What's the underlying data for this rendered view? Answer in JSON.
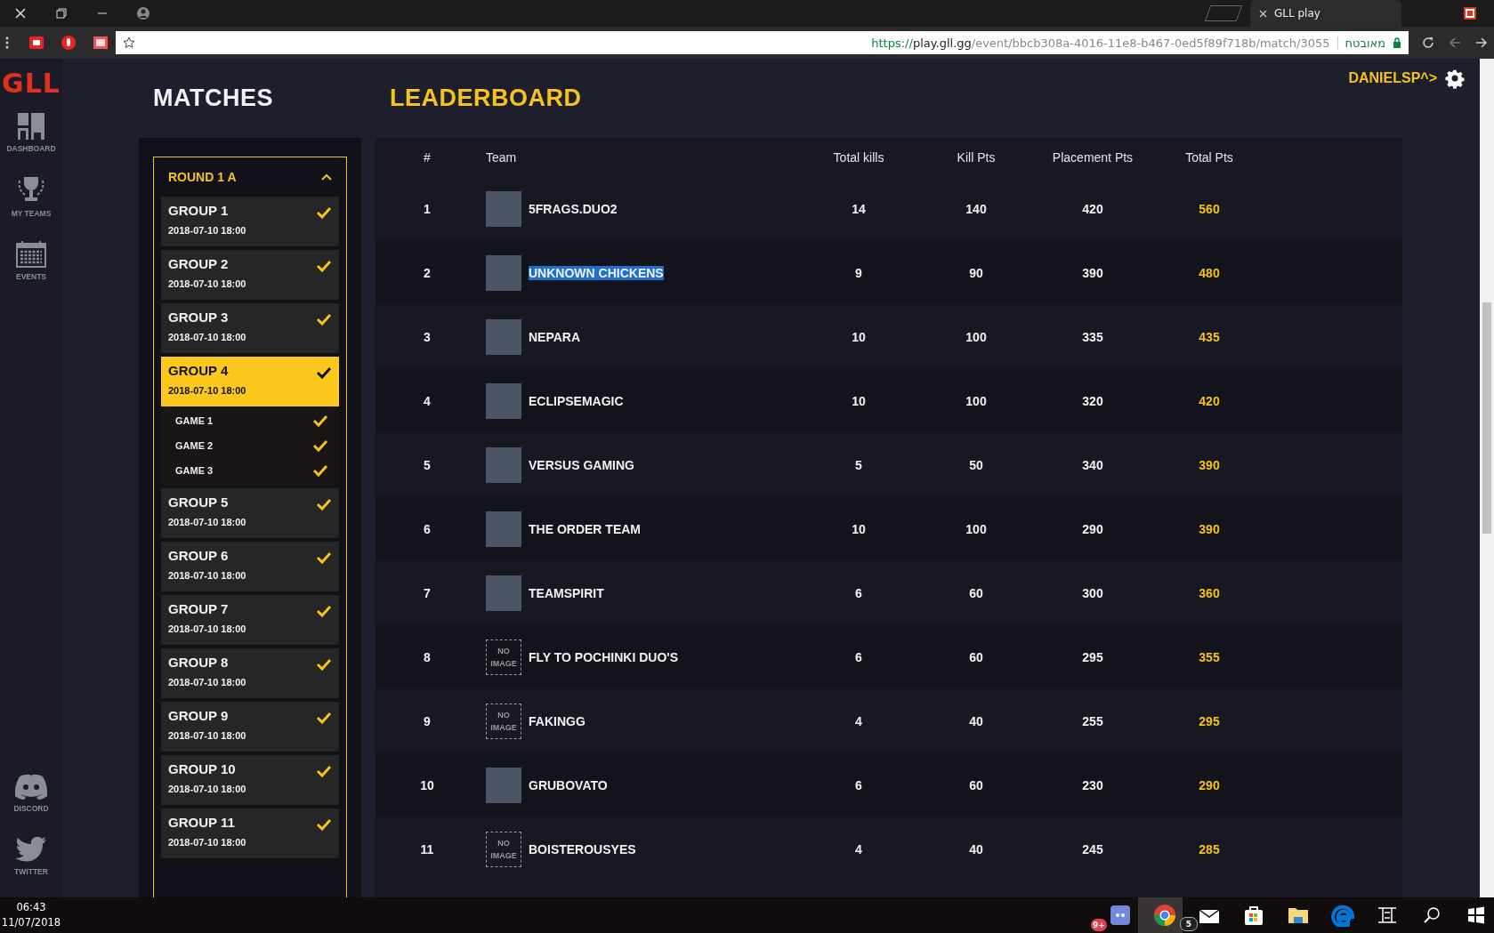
{
  "browser": {
    "tab_title": "GLL play",
    "url": {
      "scheme": "https://",
      "host": "play.gll.gg",
      "path": "/event/bbcb308a-4016-11e8-b467-0ed5f89f718b/match/3055"
    },
    "security_label": "מאובטח"
  },
  "sidebar": {
    "logo": "GLL",
    "items": [
      {
        "label": "DASHBOARD",
        "kind": "dashboard"
      },
      {
        "label": "MY TEAMS",
        "kind": "trophy"
      },
      {
        "label": "EVENTS",
        "kind": "calendar"
      }
    ],
    "social": [
      {
        "label": "DISCORD",
        "kind": "discord"
      },
      {
        "label": "TWITTER",
        "kind": "twitter"
      }
    ]
  },
  "header": {
    "tabs": [
      {
        "label": "MATCHES",
        "selected": false
      },
      {
        "label": "LEADERBOARD",
        "selected": true
      }
    ],
    "user": "DANIELSP^>"
  },
  "matches": {
    "round": {
      "title": "ROUND 1 A",
      "expanded": true
    },
    "groups": [
      {
        "name": "GROUP 1",
        "date": "2018-07-10 18:00",
        "checked": true,
        "selected": false
      },
      {
        "name": "GROUP 2",
        "date": "2018-07-10 18:00",
        "checked": true,
        "selected": false
      },
      {
        "name": "GROUP 3",
        "date": "2018-07-10 18:00",
        "checked": true,
        "selected": false
      },
      {
        "name": "GROUP 4",
        "date": "2018-07-10 18:00",
        "checked": true,
        "selected": true,
        "children": [
          {
            "name": "GAME 1",
            "checked": true
          },
          {
            "name": "GAME 2",
            "checked": true
          },
          {
            "name": "GAME 3",
            "checked": true
          }
        ]
      },
      {
        "name": "GROUP 5",
        "date": "2018-07-10 18:00",
        "checked": true,
        "selected": false
      },
      {
        "name": "GROUP 6",
        "date": "2018-07-10 18:00",
        "checked": true,
        "selected": false
      },
      {
        "name": "GROUP 7",
        "date": "2018-07-10 18:00",
        "checked": true,
        "selected": false
      },
      {
        "name": "GROUP 8",
        "date": "2018-07-10 18:00",
        "checked": true,
        "selected": false
      },
      {
        "name": "GROUP 9",
        "date": "2018-07-10 18:00",
        "checked": true,
        "selected": false
      },
      {
        "name": "GROUP 10",
        "date": "2018-07-10 18:00",
        "checked": true,
        "selected": false
      },
      {
        "name": "GROUP 11",
        "date": "2018-07-10 18:00",
        "checked": true,
        "selected": false
      }
    ]
  },
  "leaderboard": {
    "columns": [
      "#",
      "Team",
      "Total kills",
      "Kill Pts",
      "Placement Pts",
      "Total Pts"
    ],
    "rows": [
      {
        "rank": "1",
        "has_logo": true,
        "team": "5FRAGS.DUO2",
        "text_selected": false,
        "total_kills": "14",
        "kill_pts": "140",
        "placement_pts": "420",
        "total_pts": "560"
      },
      {
        "rank": "2",
        "has_logo": true,
        "team": "UNKNOWN CHICKENS",
        "text_selected": true,
        "total_kills": "9",
        "kill_pts": "90",
        "placement_pts": "390",
        "total_pts": "480"
      },
      {
        "rank": "3",
        "has_logo": true,
        "team": "NEPARA",
        "text_selected": false,
        "total_kills": "10",
        "kill_pts": "100",
        "placement_pts": "335",
        "total_pts": "435"
      },
      {
        "rank": "4",
        "has_logo": true,
        "team": "ECLIPSEMAGIC",
        "text_selected": false,
        "total_kills": "10",
        "kill_pts": "100",
        "placement_pts": "320",
        "total_pts": "420"
      },
      {
        "rank": "5",
        "has_logo": true,
        "team": "VERSUS GAMING",
        "text_selected": false,
        "total_kills": "5",
        "kill_pts": "50",
        "placement_pts": "340",
        "total_pts": "390"
      },
      {
        "rank": "6",
        "has_logo": true,
        "team": "THE ORDER TEAM",
        "text_selected": false,
        "total_kills": "10",
        "kill_pts": "100",
        "placement_pts": "290",
        "total_pts": "390"
      },
      {
        "rank": "7",
        "has_logo": true,
        "team": "TEAMSPIRIT",
        "text_selected": false,
        "total_kills": "6",
        "kill_pts": "60",
        "placement_pts": "300",
        "total_pts": "360"
      },
      {
        "rank": "8",
        "has_logo": false,
        "logo_text": "NO IMAGE",
        "team": "FLY TO POCHINKI DUO'S",
        "text_selected": false,
        "total_kills": "6",
        "kill_pts": "60",
        "placement_pts": "295",
        "total_pts": "355"
      },
      {
        "rank": "9",
        "has_logo": false,
        "logo_text": "NO IMAGE",
        "team": "FAKINGG",
        "text_selected": false,
        "total_kills": "4",
        "kill_pts": "40",
        "placement_pts": "255",
        "total_pts": "295"
      },
      {
        "rank": "10",
        "has_logo": true,
        "team": "GRUBOVATO",
        "text_selected": false,
        "total_kills": "6",
        "kill_pts": "60",
        "placement_pts": "230",
        "total_pts": "290"
      },
      {
        "rank": "11",
        "has_logo": false,
        "logo_text": "NO IMAGE",
        "team": "BOISTEROUSYES",
        "text_selected": false,
        "total_kills": "4",
        "kill_pts": "40",
        "placement_pts": "245",
        "total_pts": "285"
      }
    ]
  },
  "taskbar": {
    "time": "06:43",
    "date": "11/07/2018",
    "apps": [
      {
        "kind": "discord",
        "badge": "9+",
        "active": false
      },
      {
        "kind": "chrome",
        "active": true
      },
      {
        "kind": "mail",
        "badge": "5",
        "active": false
      },
      {
        "kind": "store",
        "active": false
      },
      {
        "kind": "explorer",
        "active": false
      },
      {
        "kind": "edge",
        "active": false
      }
    ]
  }
}
